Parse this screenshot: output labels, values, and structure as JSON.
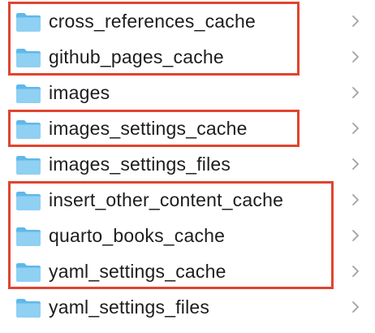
{
  "folders": [
    {
      "name": "cross_references_cache"
    },
    {
      "name": "github_pages_cache"
    },
    {
      "name": "images"
    },
    {
      "name": "images_settings_cache"
    },
    {
      "name": "images_settings_files"
    },
    {
      "name": "insert_other_content_cache"
    },
    {
      "name": "quarto_books_cache"
    },
    {
      "name": "yaml_settings_cache"
    },
    {
      "name": "yaml_settings_files"
    }
  ],
  "icons": {
    "folder": "folder-icon",
    "chevron": "chevron-right-icon"
  },
  "colors": {
    "folder_light": "#9dd6f5",
    "folder_dark": "#5fb8ea",
    "text": "#1d1d1f",
    "chevron": "#a1a1a6",
    "highlight": "#e0442f"
  }
}
